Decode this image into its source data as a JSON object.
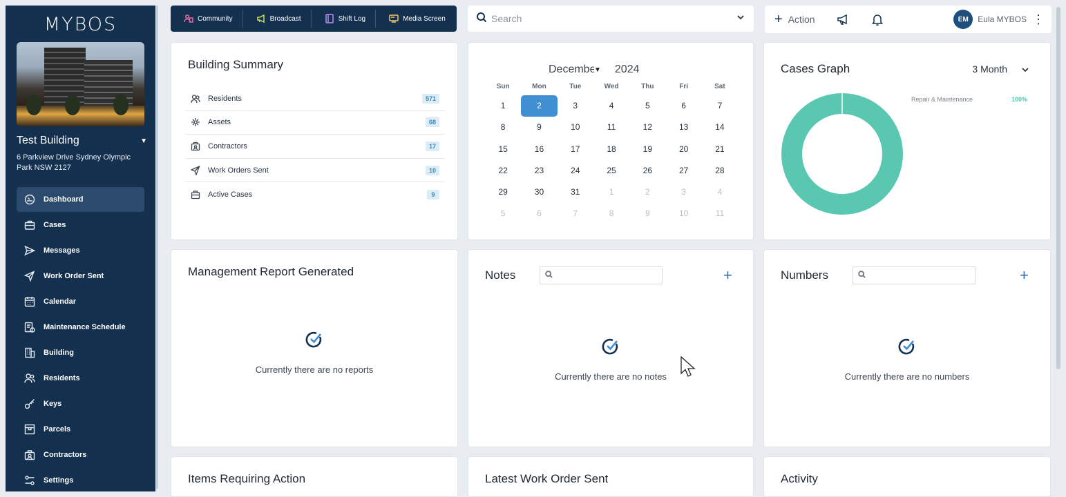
{
  "sidebar": {
    "logo": "MYBOS",
    "building_name": "Test Building",
    "address": "6 Parkview Drive Sydney Olympic Park NSW 2127",
    "items": [
      {
        "label": "Dashboard",
        "icon": "dashboard-icon",
        "active": true
      },
      {
        "label": "Cases",
        "icon": "cases-icon"
      },
      {
        "label": "Messages",
        "icon": "messages-icon"
      },
      {
        "label": "Work Order Sent",
        "icon": "work-order-icon"
      },
      {
        "label": "Calendar",
        "icon": "calendar-icon"
      },
      {
        "label": "Maintenance Schedule",
        "icon": "maintenance-icon"
      },
      {
        "label": "Building",
        "icon": "building-icon"
      },
      {
        "label": "Residents",
        "icon": "residents-icon"
      },
      {
        "label": "Keys",
        "icon": "keys-icon"
      },
      {
        "label": "Parcels",
        "icon": "parcels-icon"
      },
      {
        "label": "Contractors",
        "icon": "contractors-icon"
      },
      {
        "label": "Settings",
        "icon": "settings-icon"
      }
    ]
  },
  "topbar": {
    "community": "Community",
    "broadcast": "Broadcast",
    "shift_log": "Shift Log",
    "media_screen": "Media Screen"
  },
  "search": {
    "placeholder": "Search"
  },
  "header": {
    "action_label": "Action",
    "user_initials": "EM",
    "user_name": "Eula MYBOS"
  },
  "building_summary": {
    "title": "Building Summary",
    "rows": [
      {
        "label": "Residents",
        "count": "571"
      },
      {
        "label": "Assets",
        "count": "68"
      },
      {
        "label": "Contractors",
        "count": "17"
      },
      {
        "label": "Work Orders Sent",
        "count": "10"
      },
      {
        "label": "Active Cases",
        "count": "9"
      }
    ]
  },
  "calendar": {
    "month": "December",
    "year": "2024",
    "weekdays": [
      "Sun",
      "Mon",
      "Tue",
      "Wed",
      "Thu",
      "Fri",
      "Sat"
    ],
    "selected_day": "2",
    "days": [
      [
        "1",
        "2",
        "3",
        "4",
        "5",
        "6",
        "7"
      ],
      [
        "8",
        "9",
        "10",
        "11",
        "12",
        "13",
        "14"
      ],
      [
        "15",
        "16",
        "17",
        "18",
        "19",
        "20",
        "21"
      ],
      [
        "22",
        "23",
        "24",
        "25",
        "26",
        "27",
        "28"
      ],
      [
        "29",
        "30",
        "31",
        "1",
        "2",
        "3",
        "4"
      ],
      [
        "5",
        "6",
        "7",
        "8",
        "9",
        "10",
        "11"
      ]
    ]
  },
  "cases_graph": {
    "title": "Cases Graph",
    "range": "3 Month",
    "legend": [
      {
        "label": "Repair & Maintenance",
        "value": "100%",
        "color": "#5ac8b0"
      }
    ]
  },
  "management_report": {
    "title": "Management Report Generated",
    "empty": "Currently there are no reports"
  },
  "notes": {
    "title": "Notes",
    "empty": "Currently there are no notes"
  },
  "numbers": {
    "title": "Numbers",
    "empty": "Currently there are no numbers"
  },
  "items_requiring_action": {
    "title": "Items Requiring Action"
  },
  "latest_work_order": {
    "title": "Latest Work Order Sent"
  },
  "activity": {
    "title": "Activity"
  },
  "colors": {
    "sidebar": "#14304f",
    "accent": "#3f8fd2",
    "donut": "#5ac8b0"
  }
}
